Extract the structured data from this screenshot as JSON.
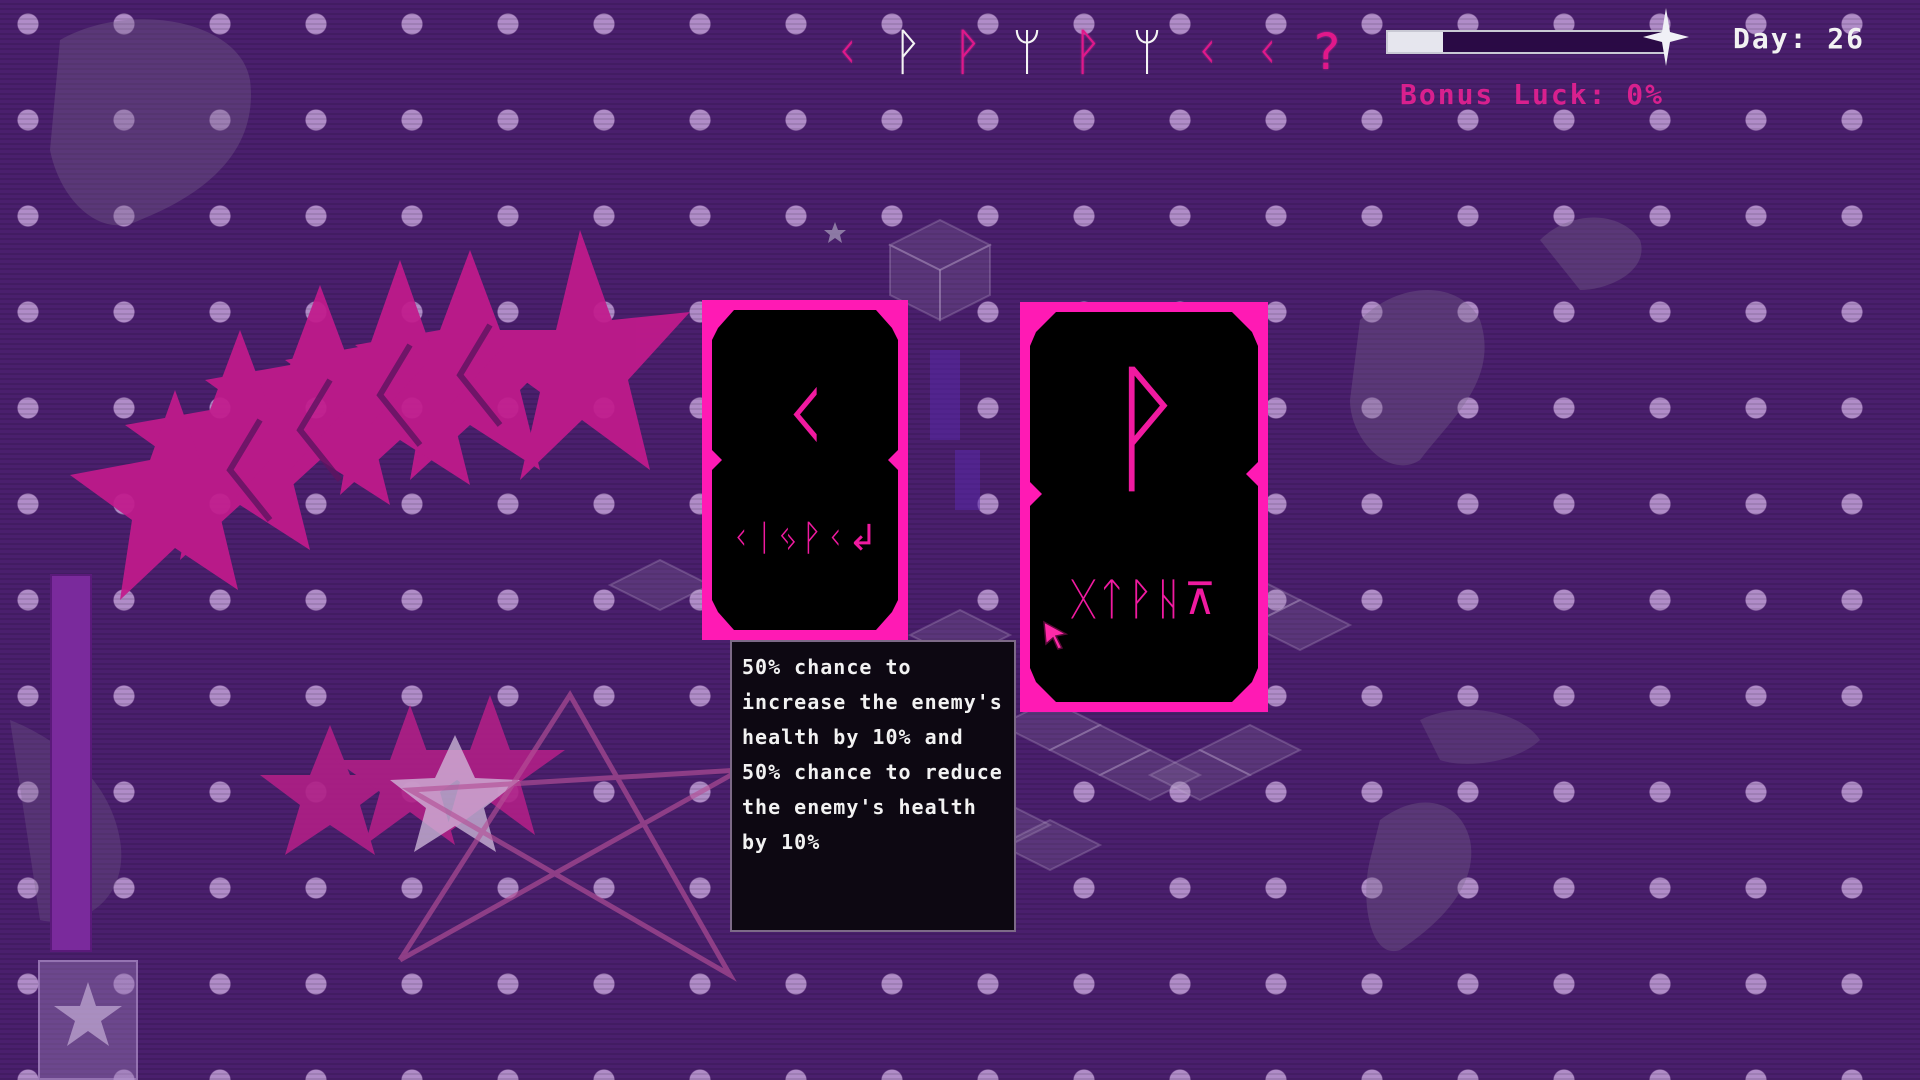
{
  "hud": {
    "rune_history": [
      {
        "glyph": "ᚲ",
        "color": "pink"
      },
      {
        "glyph": "ᚹ",
        "color": "white"
      },
      {
        "glyph": "ᚹ",
        "color": "pink"
      },
      {
        "glyph": "ᛘ",
        "color": "white"
      },
      {
        "glyph": "ᚹ",
        "color": "pink"
      },
      {
        "glyph": "ᛘ",
        "color": "white"
      },
      {
        "glyph": "ᚲ",
        "color": "pink"
      },
      {
        "glyph": "ᚲ",
        "color": "pink"
      },
      {
        "glyph": "?",
        "color": "pink"
      }
    ],
    "luck_progress": 0.2,
    "day_label": "Day: 26",
    "bonus_luck": "Bonus Luck: 0%"
  },
  "cards": {
    "left": {
      "rune": "ᚲ",
      "script": "ᚲᛁᛃᚹᚲ↲"
    },
    "right": {
      "rune": "ᚹ",
      "script": "ᚷᛏᚹᚺ⊼"
    }
  },
  "tooltip": {
    "text": "50% chance to increase the enemy's health by 10% and 50% chance to reduce the enemy's health by 10%"
  },
  "colors": {
    "background": "#4a1f6d",
    "accent_pink": "#ff1ab4",
    "rune_pink": "#f01aa0",
    "bonus_text": "#d8208e"
  },
  "icons": [
    "luck-star-icon",
    "cursor-icon",
    "ability-star-icon"
  ]
}
